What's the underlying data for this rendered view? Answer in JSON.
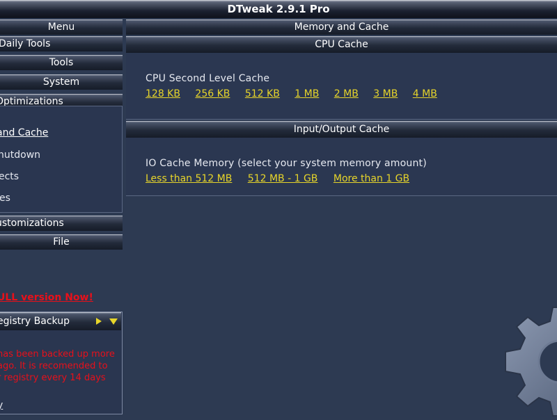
{
  "window": {
    "title": "DTweak 2.9.1 Pro"
  },
  "sidebar": {
    "menu_label": "Menu",
    "buttons": [
      "Daily Tools",
      "Tools",
      "System",
      "Optimizations"
    ],
    "sub_items": [
      "and Cache",
      "hutdown",
      "ects",
      "es"
    ],
    "lower_buttons": [
      "ustomizations",
      "File"
    ],
    "warning": "ULL version Now!",
    "backup": {
      "title": "egistry Backup",
      "message": "has been backed up more\nago. It is recomended to\nr registry every 14 days",
      "link": "y"
    }
  },
  "main": {
    "header": "Memory and Cache",
    "cpu": {
      "header": "CPU Cache",
      "label": "CPU Second Level Cache",
      "options": [
        "128 KB",
        "256 KB",
        "512 KB",
        "1 MB",
        "2 MB",
        "3 MB",
        "4 MB"
      ]
    },
    "io": {
      "header": "Input/Output Cache",
      "label": "IO Cache Memory (select your system memory amount)",
      "options": [
        "Less than 512 MB",
        "512 MB - 1 GB",
        "More than 1 GB"
      ]
    }
  },
  "colors": {
    "background": "#2d3a52",
    "link": "#e7d52a",
    "warning": "#e8101a"
  },
  "icons": {
    "backup_expand": "triangle-right-icon",
    "backup_collapse": "triangle-down-icon",
    "logo": "gear-icon"
  }
}
